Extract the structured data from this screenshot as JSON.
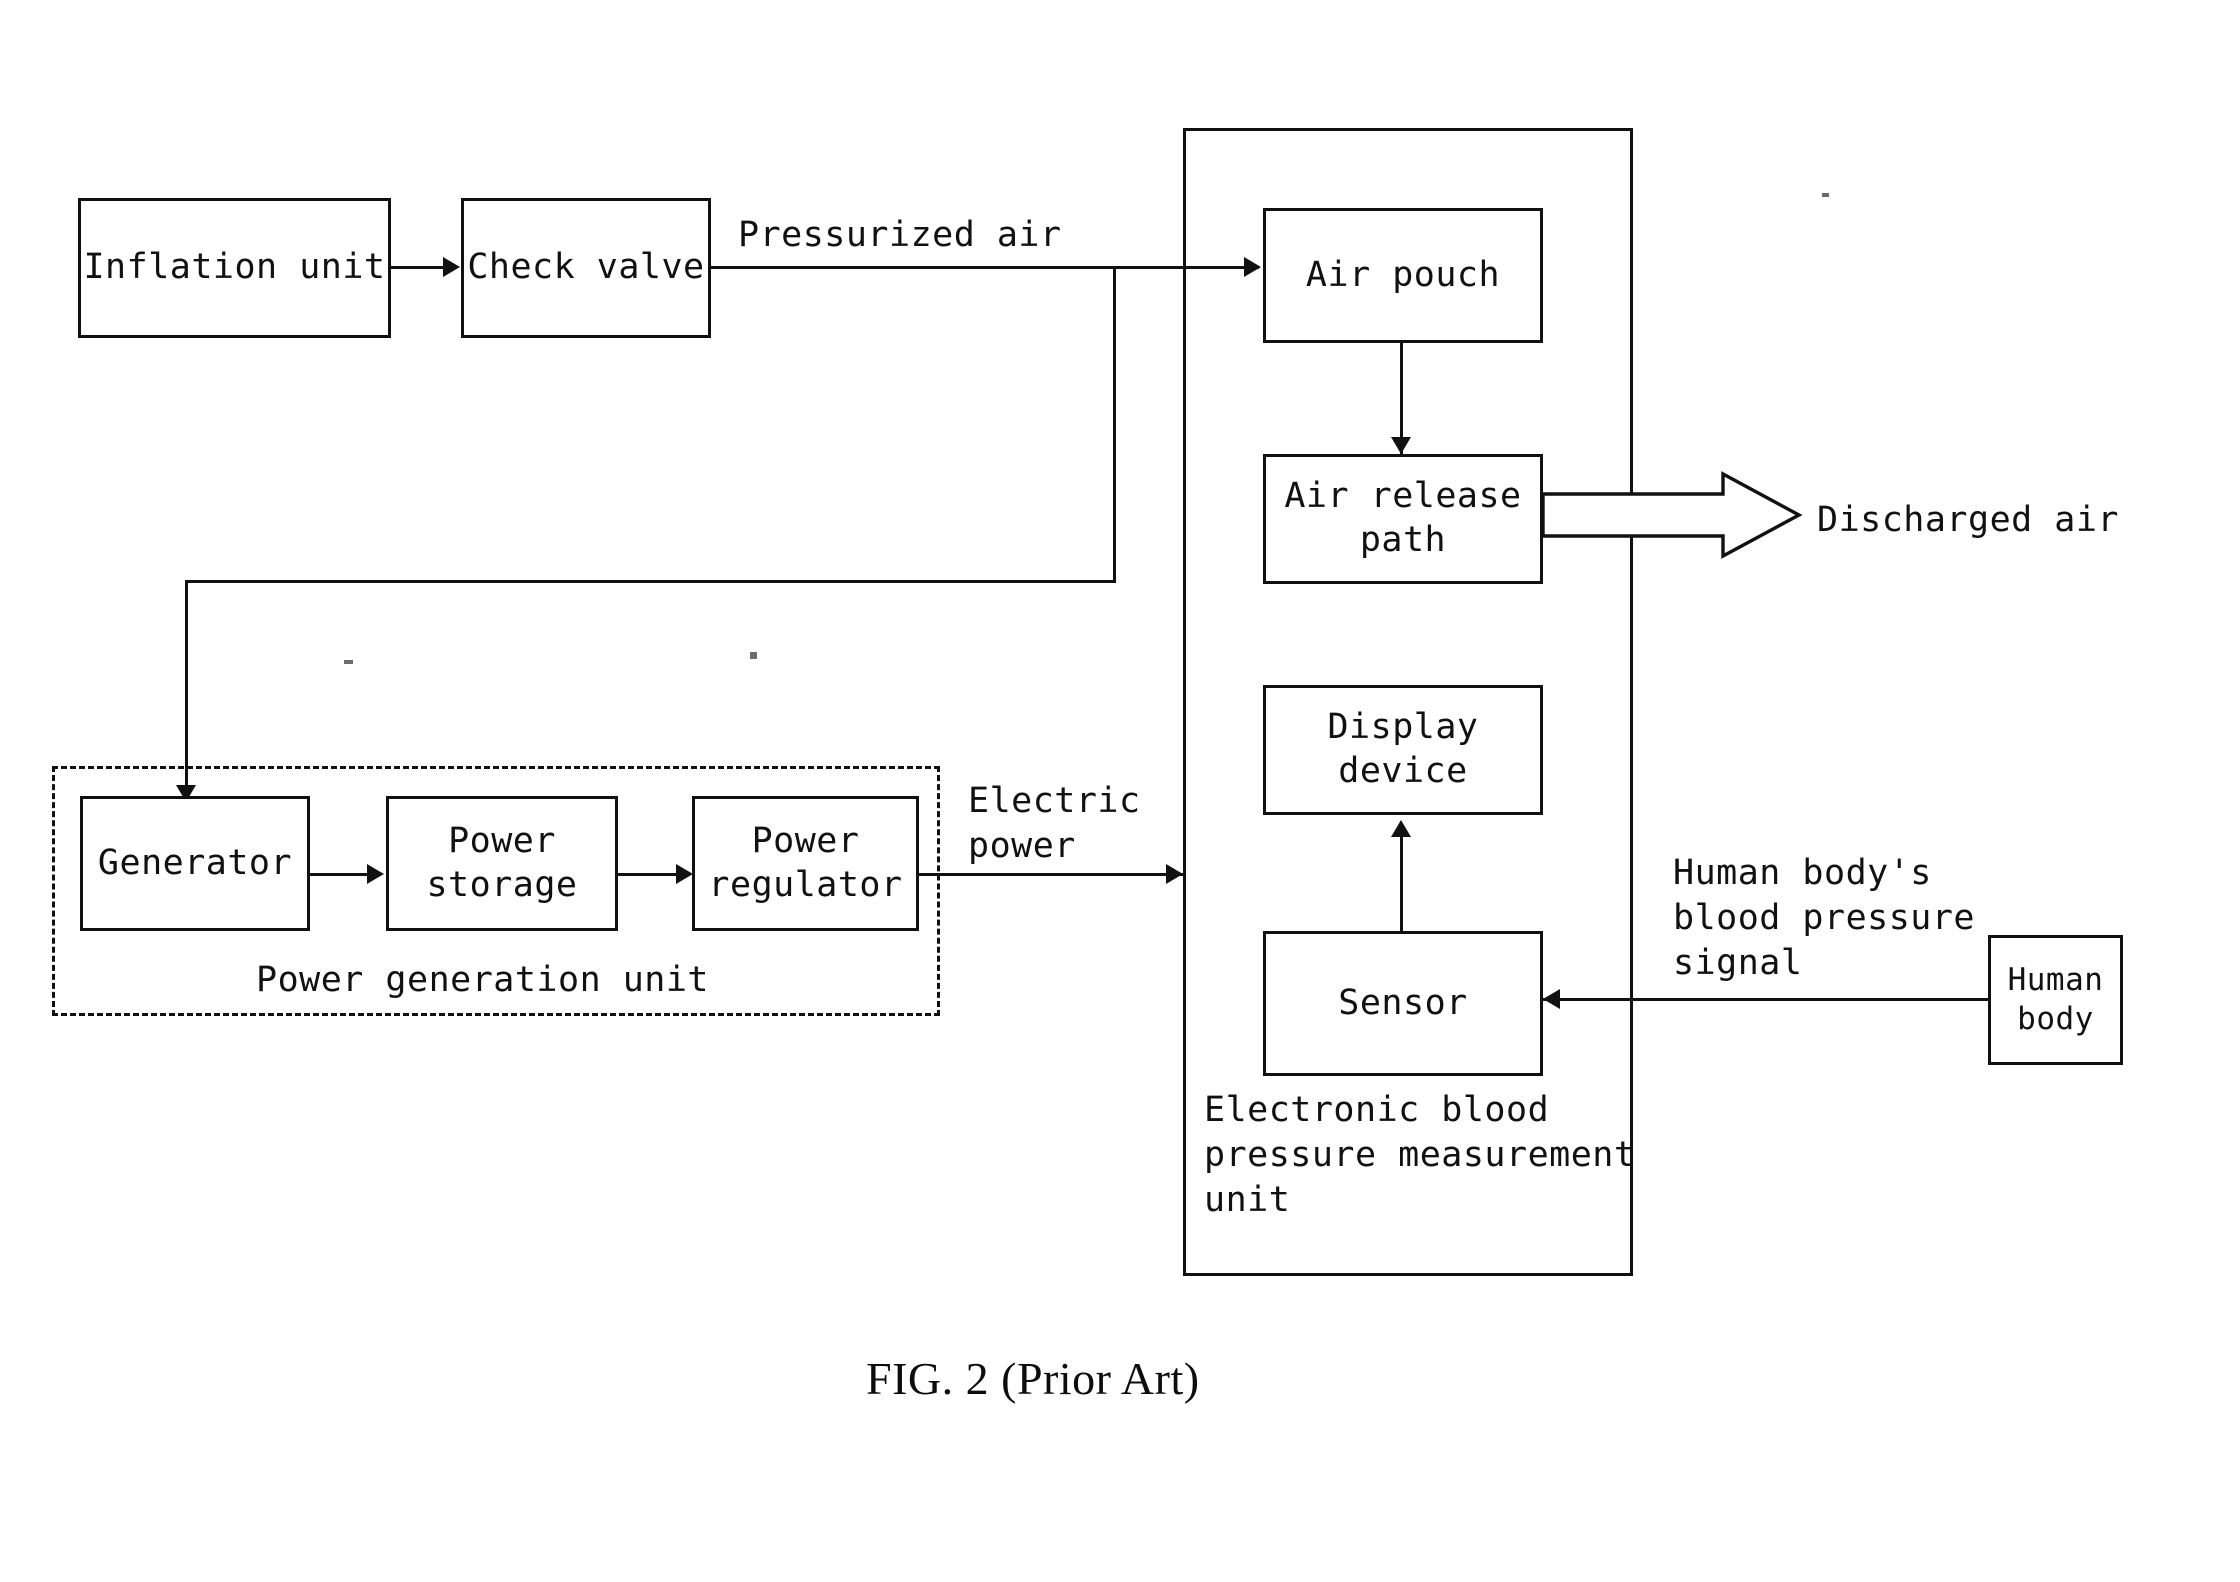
{
  "figure": {
    "caption": "FIG. 2 (Prior Art)",
    "number": "2",
    "qualifier": "Prior Art"
  },
  "blocks": {
    "inflation_unit": "Inflation unit",
    "check_valve": "Check valve",
    "air_pouch": "Air pouch",
    "air_release_path": "Air release\npath",
    "display_device": "Display\ndevice",
    "sensor": "Sensor",
    "human_body": "Human\nbody",
    "generator": "Generator",
    "power_storage": "Power\nstorage",
    "power_regulator": "Power\nregulator"
  },
  "groups": {
    "measurement_unit": "Electronic blood\npressure measurement\nunit",
    "power_generation_unit": "Power generation unit"
  },
  "flow_labels": {
    "pressurized_air": "Pressurized air",
    "electric_power": "Electric\npower",
    "discharged_air": "Discharged air",
    "blood_pressure_signal": "Human body's\nblood pressure\nsignal"
  },
  "colors": {
    "ink": "#111111",
    "paper": "#ffffff"
  },
  "diagram_type": "block-flow-diagram"
}
